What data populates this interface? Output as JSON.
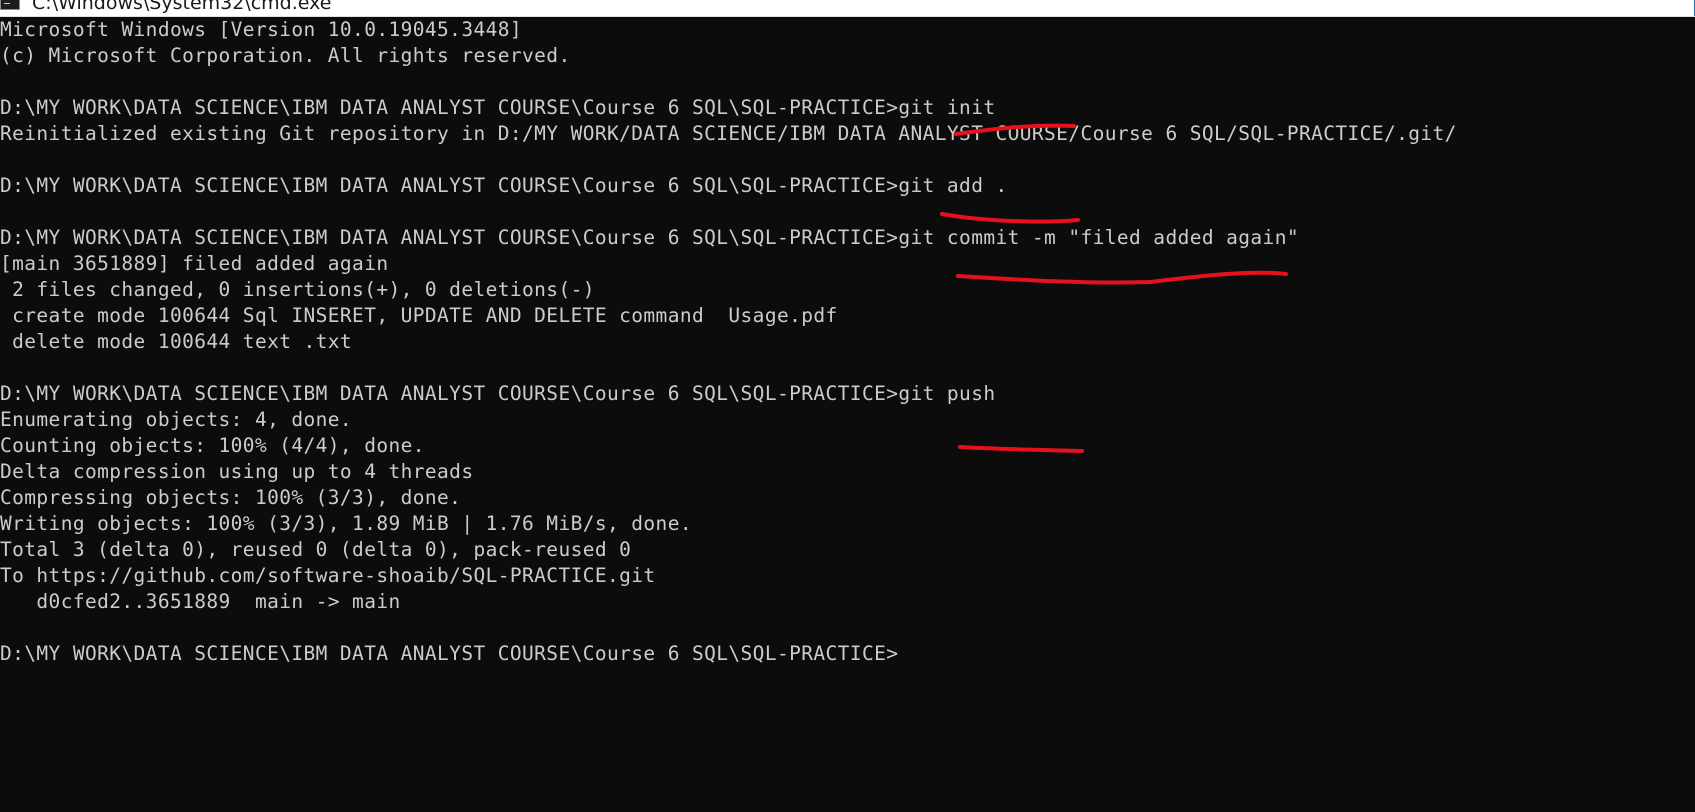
{
  "window": {
    "title": "C:\\Windows\\System32\\cmd.exe",
    "icon": "cmd-icon"
  },
  "console": {
    "lines": [
      "Microsoft Windows [Version 10.0.19045.3448]",
      "(c) Microsoft Corporation. All rights reserved.",
      "",
      "D:\\MY WORK\\DATA SCIENCE\\IBM DATA ANALYST COURSE\\Course 6 SQL\\SQL-PRACTICE>git init",
      "Reinitialized existing Git repository in D:/MY WORK/DATA SCIENCE/IBM DATA ANALYST COURSE/Course 6 SQL/SQL-PRACTICE/.git/",
      "",
      "D:\\MY WORK\\DATA SCIENCE\\IBM DATA ANALYST COURSE\\Course 6 SQL\\SQL-PRACTICE>git add .",
      "",
      "D:\\MY WORK\\DATA SCIENCE\\IBM DATA ANALYST COURSE\\Course 6 SQL\\SQL-PRACTICE>git commit -m \"filed added again\"",
      "[main 3651889] filed added again",
      " 2 files changed, 0 insertions(+), 0 deletions(-)",
      " create mode 100644 Sql INSERET, UPDATE AND DELETE command  Usage.pdf",
      " delete mode 100644 text .txt",
      "",
      "D:\\MY WORK\\DATA SCIENCE\\IBM DATA ANALYST COURSE\\Course 6 SQL\\SQL-PRACTICE>git push",
      "Enumerating objects: 4, done.",
      "Counting objects: 100% (4/4), done.",
      "Delta compression using up to 4 threads",
      "Compressing objects: 100% (3/3), done.",
      "Writing objects: 100% (3/3), 1.89 MiB | 1.76 MiB/s, done.",
      "Total 3 (delta 0), reused 0 (delta 0), pack-reused 0",
      "To https://github.com/software-shoaib/SQL-PRACTICE.git",
      "   d0cfed2..3651889  main -> main",
      "",
      "D:\\MY WORK\\DATA SCIENCE\\IBM DATA ANALYST COURSE\\Course 6 SQL\\SQL-PRACTICE>"
    ]
  },
  "colors": {
    "background": "#0c0c0c",
    "text": "#cccccc",
    "annotation": "#e8101c"
  }
}
